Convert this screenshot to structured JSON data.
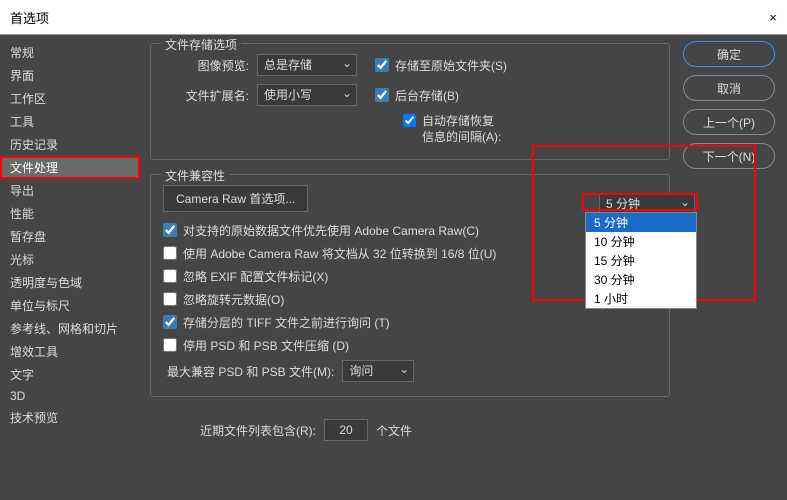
{
  "title": "首选项",
  "sidebar": {
    "items": [
      "常规",
      "界面",
      "工作区",
      "工具",
      "历史记录",
      "文件处理",
      "导出",
      "性能",
      "暂存盘",
      "光标",
      "透明度与色域",
      "单位与标尺",
      "参考线、网格和切片",
      "增效工具",
      "文字",
      "3D",
      "技术预览"
    ],
    "selected": "文件处理"
  },
  "buttons": {
    "ok": "确定",
    "cancel": "取消",
    "prev": "上一个(P)",
    "next": "下一个(N)"
  },
  "storage": {
    "legend": "文件存储选项",
    "preview_label": "图像预览:",
    "preview_value": "总是存储",
    "ext_label": "文件扩展名:",
    "ext_value": "使用小写",
    "save_orig": "存储至原始文件夹(S)",
    "bg_save": "后台存储(B)",
    "auto_save_label": "自动存储恢复\n信息的间隔(A):"
  },
  "interval": {
    "selected": "5 分钟",
    "options": [
      "5 分钟",
      "10 分钟",
      "15 分钟",
      "30 分钟",
      "1 小时"
    ]
  },
  "compat": {
    "legend": "文件兼容性",
    "camera_btn": "Camera Raw 首选项...",
    "chk1": "对支持的原始数据文件优先使用 Adobe Camera Raw(C)",
    "chk2": "使用 Adobe Camera Raw 将文档从 32 位转换到 16/8 位(U)",
    "chk3": "忽略 EXIF 配置文件标记(X)",
    "chk4": "忽略旋转元数据(O)",
    "chk5": "存储分层的 TIFF 文件之前进行询问 (T)",
    "chk6": "停用 PSD 和 PSB 文件压缩 (D)",
    "max_label": "最大兼容 PSD 和 PSB 文件(M):",
    "max_value": "询问"
  },
  "recent": {
    "label": "近期文件列表包含(R):",
    "value": "20",
    "suffix": "个文件"
  }
}
